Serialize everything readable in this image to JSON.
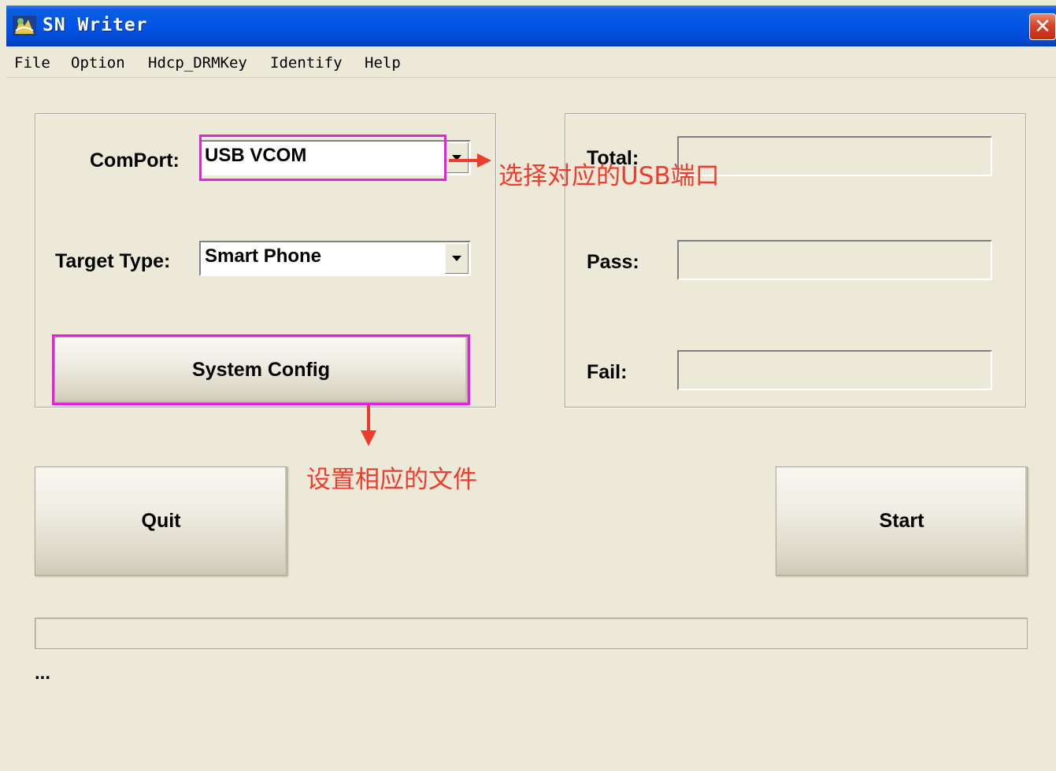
{
  "window": {
    "title": "SN Writer"
  },
  "menu": [
    "File",
    "Option",
    "Hdcp_DRMKey",
    "Identify",
    "Help"
  ],
  "left_panel": {
    "comport_label": "ComPort:",
    "comport_value": "USB VCOM",
    "target_type_label": "Target Type:",
    "target_type_value": "Smart Phone",
    "system_config_label": "System Config"
  },
  "right_panel": {
    "total_label": "Total:",
    "pass_label": "Pass:",
    "fail_label": "Fail:",
    "total_value": "",
    "pass_value": "",
    "fail_value": ""
  },
  "buttons": {
    "quit_label": "Quit",
    "start_label": "Start"
  },
  "status": {
    "text": "..."
  },
  "annotations": {
    "comport_note": "选择对应的USB端口",
    "config_note": "设置相应的文件",
    "highlight_color": "#E81FE3",
    "arrow_color": "#F03B2C"
  },
  "colors": {
    "titlebar": "#0254E6",
    "window_bg": "#ECE9D8"
  }
}
